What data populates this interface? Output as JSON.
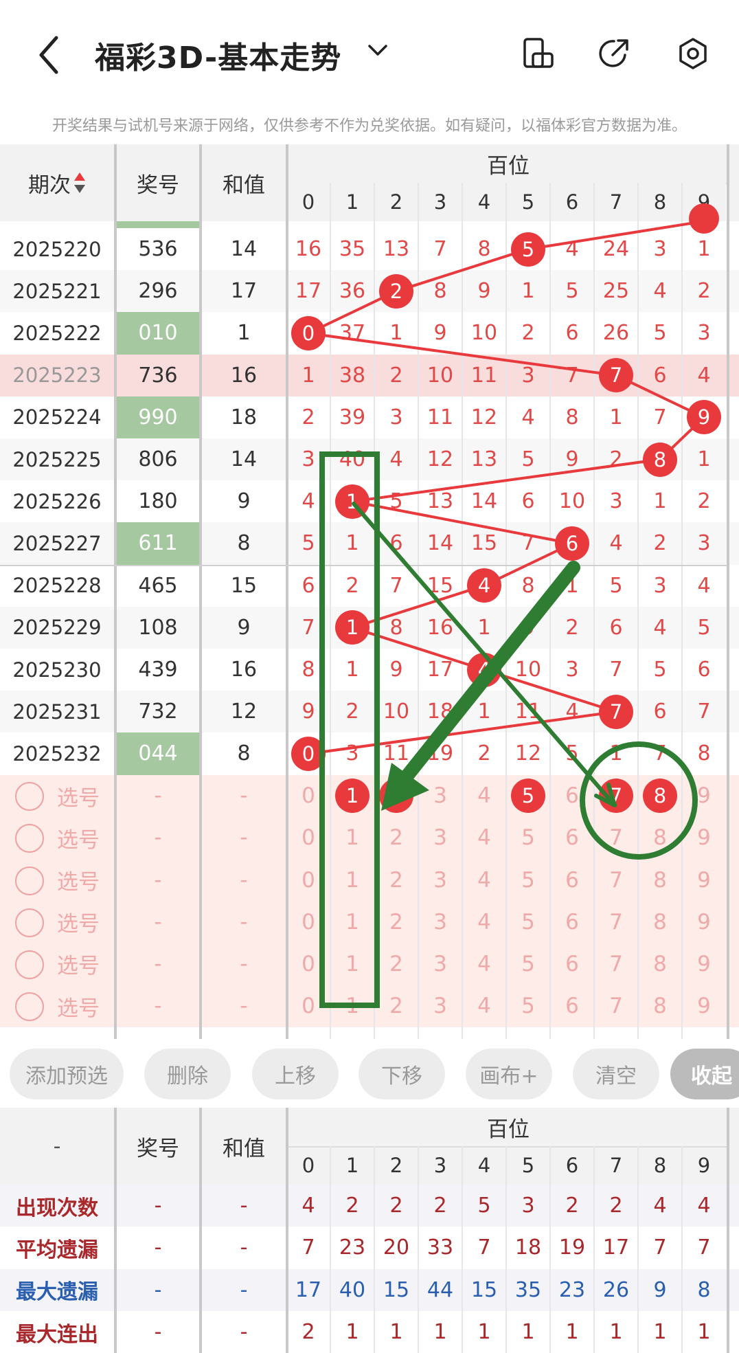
{
  "header": {
    "title": "福彩3D-基本走势",
    "icons": [
      "back-icon",
      "chevron-down-icon",
      "phone-rotate-icon",
      "share-icon",
      "settings-icon"
    ]
  },
  "notice": "开奖结果与试机号来源于网络，仅供参考不作为兑奖依据。如有疑问，以福体彩官方数据为准。",
  "table": {
    "period_label": "期次",
    "number_label": "奖号",
    "sum_label": "和值",
    "position_label": "百位",
    "digit_headers": [
      "0",
      "1",
      "2",
      "3",
      "4",
      "5",
      "6",
      "7",
      "8",
      "9"
    ],
    "rows": [
      {
        "period": "2025220",
        "number": "536",
        "sum": "14",
        "cells": [
          "16",
          "35",
          "13",
          "7",
          "8",
          "5",
          "4",
          "24",
          "3",
          "1"
        ],
        "hit": 5,
        "green": false
      },
      {
        "period": "2025221",
        "number": "296",
        "sum": "17",
        "cells": [
          "17",
          "36",
          "2",
          "8",
          "9",
          "1",
          "5",
          "25",
          "4",
          "2"
        ],
        "hit": 2,
        "green": false
      },
      {
        "period": "2025222",
        "number": "010",
        "sum": "1",
        "cells": [
          "0",
          "37",
          "1",
          "9",
          "10",
          "2",
          "6",
          "26",
          "5",
          "3"
        ],
        "hit": 0,
        "green": true
      },
      {
        "period": "2025223",
        "number": "736",
        "sum": "16",
        "cells": [
          "1",
          "38",
          "2",
          "10",
          "11",
          "3",
          "7",
          "7",
          "6",
          "4"
        ],
        "hit": 7,
        "green": false
      },
      {
        "period": "2025224",
        "number": "990",
        "sum": "18",
        "cells": [
          "2",
          "39",
          "3",
          "11",
          "12",
          "4",
          "8",
          "1",
          "7",
          "9"
        ],
        "hit": 9,
        "green": true
      },
      {
        "period": "2025225",
        "number": "806",
        "sum": "14",
        "cells": [
          "3",
          "40",
          "4",
          "12",
          "13",
          "5",
          "9",
          "2",
          "8",
          "1"
        ],
        "hit": 8,
        "green": false
      },
      {
        "period": "2025226",
        "number": "180",
        "sum": "9",
        "cells": [
          "4",
          "1",
          "5",
          "13",
          "14",
          "6",
          "10",
          "3",
          "1",
          "2"
        ],
        "hit": 1,
        "green": false
      },
      {
        "period": "2025227",
        "number": "611",
        "sum": "8",
        "cells": [
          "5",
          "1",
          "6",
          "14",
          "15",
          "7",
          "6",
          "4",
          "2",
          "3"
        ],
        "hit": 6,
        "green": true
      },
      {
        "period": "2025228",
        "number": "465",
        "sum": "15",
        "cells": [
          "6",
          "2",
          "7",
          "15",
          "4",
          "8",
          "1",
          "5",
          "3",
          "4"
        ],
        "hit": 4,
        "green": false
      },
      {
        "period": "2025229",
        "number": "108",
        "sum": "9",
        "cells": [
          "7",
          "1",
          "8",
          "16",
          "1",
          "9",
          "2",
          "6",
          "4",
          "5"
        ],
        "hit": 1,
        "green": false
      },
      {
        "period": "2025230",
        "number": "439",
        "sum": "16",
        "cells": [
          "8",
          "1",
          "9",
          "17",
          "4",
          "10",
          "3",
          "7",
          "5",
          "6"
        ],
        "hit": 4,
        "green": false
      },
      {
        "period": "2025231",
        "number": "732",
        "sum": "12",
        "cells": [
          "9",
          "2",
          "10",
          "18",
          "1",
          "11",
          "4",
          "7",
          "6",
          "7"
        ],
        "hit": 7,
        "green": false
      },
      {
        "period": "2025232",
        "number": "044",
        "sum": "8",
        "cells": [
          "0",
          "3",
          "11",
          "19",
          "2",
          "12",
          "5",
          "1",
          "7",
          "8"
        ],
        "hit": 0,
        "green": true
      }
    ],
    "pick_rows": [
      {
        "label": "选号",
        "number": "-",
        "sum": "-",
        "selected": [
          1,
          2,
          5,
          7,
          8
        ]
      },
      {
        "label": "选号",
        "number": "-",
        "sum": "-",
        "selected": []
      },
      {
        "label": "选号",
        "number": "-",
        "sum": "-",
        "selected": []
      },
      {
        "label": "选号",
        "number": "-",
        "sum": "-",
        "selected": []
      },
      {
        "label": "选号",
        "number": "-",
        "sum": "-",
        "selected": []
      },
      {
        "label": "选号",
        "number": "-",
        "sum": "-",
        "selected": []
      }
    ]
  },
  "buttons": [
    "添加预选",
    "删除",
    "上移",
    "下移",
    "画布+",
    "清空",
    "收起"
  ],
  "stats": {
    "corner_label": "-",
    "number_label": "奖号",
    "sum_label": "和值",
    "position_label": "百位",
    "digit_headers": [
      "0",
      "1",
      "2",
      "3",
      "4",
      "5",
      "6",
      "7",
      "8",
      "9"
    ],
    "rows": [
      {
        "label": "出现次数",
        "number": "-",
        "sum": "-",
        "values": [
          "4",
          "2",
          "2",
          "2",
          "5",
          "3",
          "2",
          "2",
          "4",
          "4"
        ],
        "color": "#a8282c"
      },
      {
        "label": "平均遗漏",
        "number": "-",
        "sum": "-",
        "values": [
          "7",
          "23",
          "20",
          "33",
          "7",
          "18",
          "19",
          "17",
          "7",
          "7"
        ],
        "color": "#a8282c"
      },
      {
        "label": "最大遗漏",
        "number": "-",
        "sum": "-",
        "values": [
          "17",
          "40",
          "15",
          "44",
          "15",
          "35",
          "23",
          "26",
          "9",
          "8"
        ],
        "color": "#2a5fb0"
      },
      {
        "label": "最大连出",
        "number": "-",
        "sum": "-",
        "values": [
          "2",
          "1",
          "1",
          "1",
          "1",
          "1",
          "1",
          "1",
          "1",
          "1"
        ],
        "color": "#a8282c"
      }
    ]
  },
  "colors": {
    "hit": "#e8393c",
    "green": "#a6c8a0",
    "highlight": "#f9dcdc",
    "pick_bg": "#fdece8",
    "annotation": "#2e7d32"
  }
}
